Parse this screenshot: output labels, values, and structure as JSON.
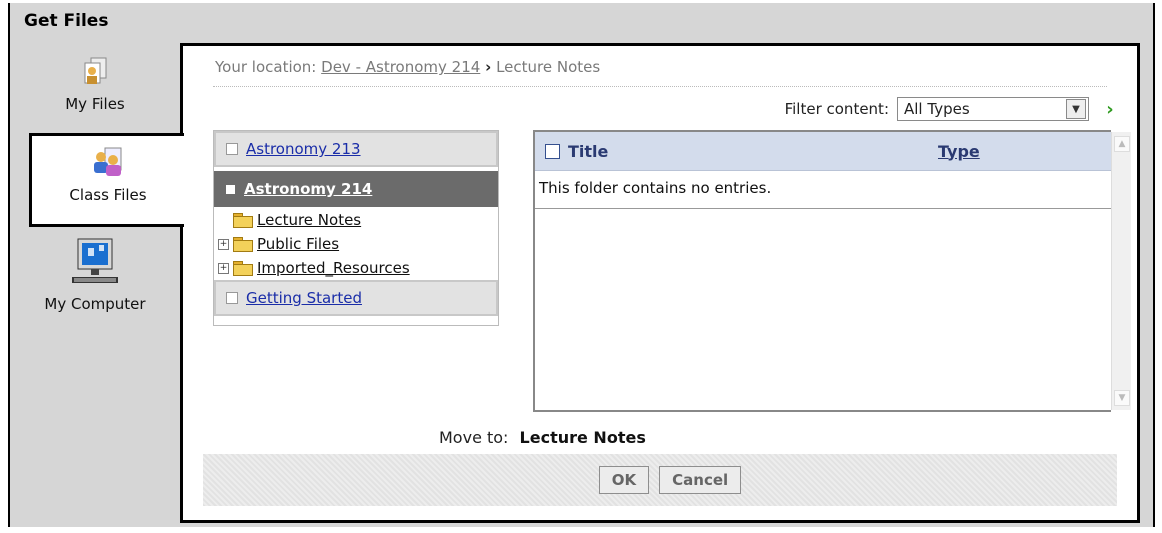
{
  "dialog": {
    "title": "Get Files"
  },
  "sidebar": {
    "tabs": [
      {
        "label": "My Files",
        "icon": "my-files-icon"
      },
      {
        "label": "Class Files",
        "icon": "class-files-icon",
        "active": true
      },
      {
        "label": "My Computer",
        "icon": "my-computer-icon"
      }
    ]
  },
  "location": {
    "prefix": "Your location:",
    "crumb_link": "Dev - Astronomy 214",
    "separator": "›",
    "current": "Lecture Notes"
  },
  "filter": {
    "label": "Filter content:",
    "selected": "All Types"
  },
  "tree": {
    "courses": [
      {
        "name": "Astronomy 213"
      },
      {
        "name": "Astronomy 214",
        "expanded": true
      },
      {
        "name": "Getting Started"
      }
    ],
    "folders": [
      {
        "name": "Lecture Notes"
      },
      {
        "name": "Public Files"
      },
      {
        "name": "Imported_Resources"
      }
    ]
  },
  "list": {
    "col_title": "Title",
    "col_type": "Type",
    "empty_message": "This folder contains no entries."
  },
  "move": {
    "label": "Move to:",
    "target": "Lecture Notes"
  },
  "buttons": {
    "ok": "OK",
    "cancel": "Cancel"
  },
  "colors": {
    "header_bg": "#d3dcec",
    "link": "#1a2da8",
    "accent_go": "#2f9a20"
  }
}
